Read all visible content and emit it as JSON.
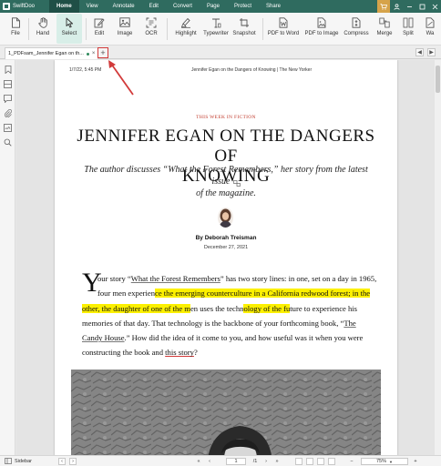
{
  "app": {
    "name": "SwiftDoo"
  },
  "menu": {
    "items": [
      "Home",
      "View",
      "Annotate",
      "Edit",
      "Convert",
      "Page",
      "Protect",
      "Share"
    ],
    "active": "Home"
  },
  "ribbon": {
    "tools": [
      {
        "label": "File",
        "icon": "file-icon"
      },
      {
        "label": "Hand",
        "icon": "hand-icon"
      },
      {
        "label": "Select",
        "icon": "cursor-icon"
      },
      {
        "label": "Edit",
        "icon": "edit-icon"
      },
      {
        "label": "Image",
        "icon": "image-icon"
      },
      {
        "label": "OCR",
        "icon": "ocr-icon"
      },
      {
        "label": "Highlight",
        "icon": "highlight-icon"
      },
      {
        "label": "Typewriter",
        "icon": "typewriter-icon"
      },
      {
        "label": "Snapshot",
        "icon": "snapshot-icon"
      },
      {
        "label": "PDF to Word",
        "icon": "pdf-to-word-icon"
      },
      {
        "label": "PDF to Image",
        "icon": "pdf-to-image-icon"
      },
      {
        "label": "Compress",
        "icon": "compress-icon"
      },
      {
        "label": "Merge",
        "icon": "merge-icon"
      },
      {
        "label": "Split",
        "icon": "split-icon"
      },
      {
        "label": "Wa",
        "icon": "watermark-icon"
      }
    ],
    "selected": "Select"
  },
  "tabs": {
    "document_tab": "1_PDFsam_Jennifer Egan on th...",
    "new_tab_symbol": "+"
  },
  "page": {
    "header_left": "1/7/22, 5:45 PM",
    "header_center": "Jennifer Egan on the Dangers of Knowing | The New Yorker",
    "kicker": "THIS WEEK IN FICTION",
    "headline_1": "JENNIFER EGAN ON THE DANGERS OF",
    "headline_2": "KNOWING",
    "dek_1": "The author discusses “What the Forest Remembers,” her story from the latest issue",
    "dek_2": "of the magazine.",
    "byline_prefix": "By ",
    "author": "Deborah Treisman",
    "date": "December 27, 2021",
    "dropcap": "Y",
    "body": {
      "l1a": "our story “",
      "l1link": "What the Forest Remembers",
      "l1b": "” has two story lines: in one, set on a day in 1965,",
      "l2a": "four men experien",
      "l2hl": "ce the emerging counterculture in a California redwood forest; in the",
      "l3hl1": "other, the daughter of one of the m",
      "l3b": "en uses the techn",
      "l3hl2": "ology of the fu",
      "l3c": "ture to experience his",
      "l4a": "memories of that day. That technology is the backbone of your forthcoming book, “",
      "l4link": "The",
      "l5link": "Candy House",
      "l5b": ".” How did the idea of it come to you, and how useful was it when you were",
      "l6a": "constructing the book and ",
      "l6ul": "this story",
      "l6b": "?"
    }
  },
  "status": {
    "sidebar_label": "Sidebar",
    "current_page": "1",
    "total_pages": "/1",
    "zoom": "75%"
  },
  "colors": {
    "brand": "#2f6b5f",
    "highlight": "#fcf000",
    "annotation_red": "#d23a3a"
  }
}
